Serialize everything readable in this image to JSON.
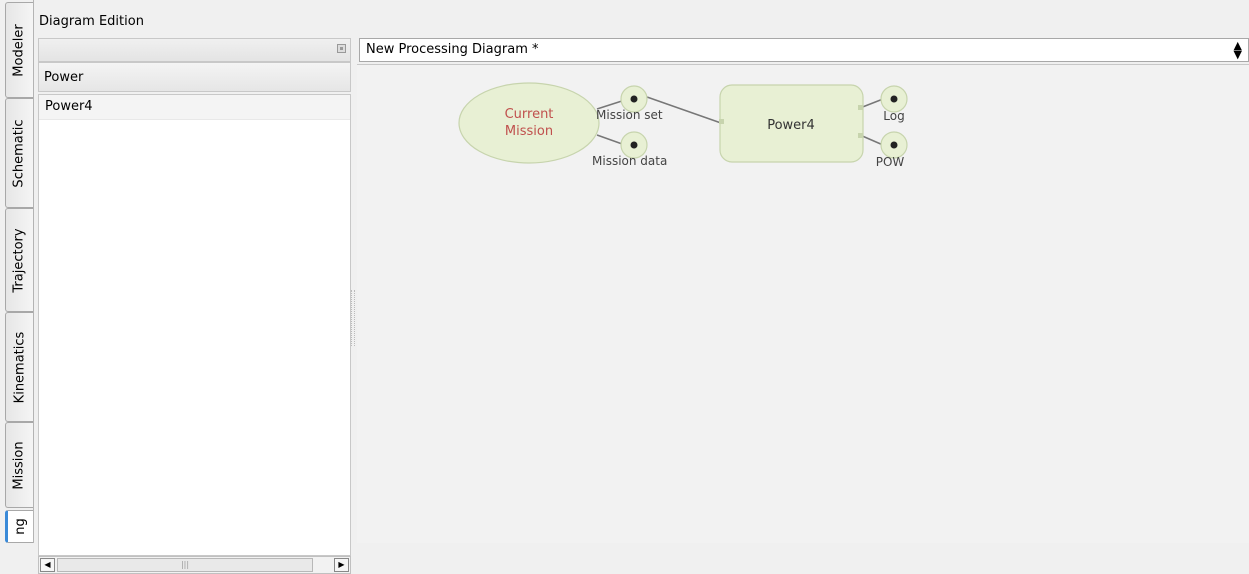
{
  "tabs": [
    {
      "label": "Modeler",
      "active": false
    },
    {
      "label": "Schematic",
      "active": false
    },
    {
      "label": "Trajectory",
      "active": false
    },
    {
      "label": "Kinematics",
      "active": false
    },
    {
      "label": "Mission",
      "active": false
    },
    {
      "label": "ng",
      "active": true
    }
  ],
  "panel": {
    "title": "Diagram Edition",
    "category": "Power",
    "items": [
      "Power4"
    ]
  },
  "diagram": {
    "selected": "New Processing Diagram *",
    "source_node": {
      "line1": "Current",
      "line2": "Mission",
      "ports": [
        "Mission set",
        "Mission data"
      ]
    },
    "process_node": {
      "label": "Power4",
      "outputs": [
        "Log",
        "POW"
      ]
    }
  },
  "colors": {
    "node_fill": "#e8f0d4",
    "node_stroke": "#c7d4ad",
    "source_text": "#c0504d",
    "accent_tab": "#3a8ad8"
  },
  "icons": {
    "float": "float-icon",
    "scroll_left": "arrow-left-icon",
    "scroll_right": "arrow-right-icon",
    "combo": "updown-arrows-icon"
  }
}
